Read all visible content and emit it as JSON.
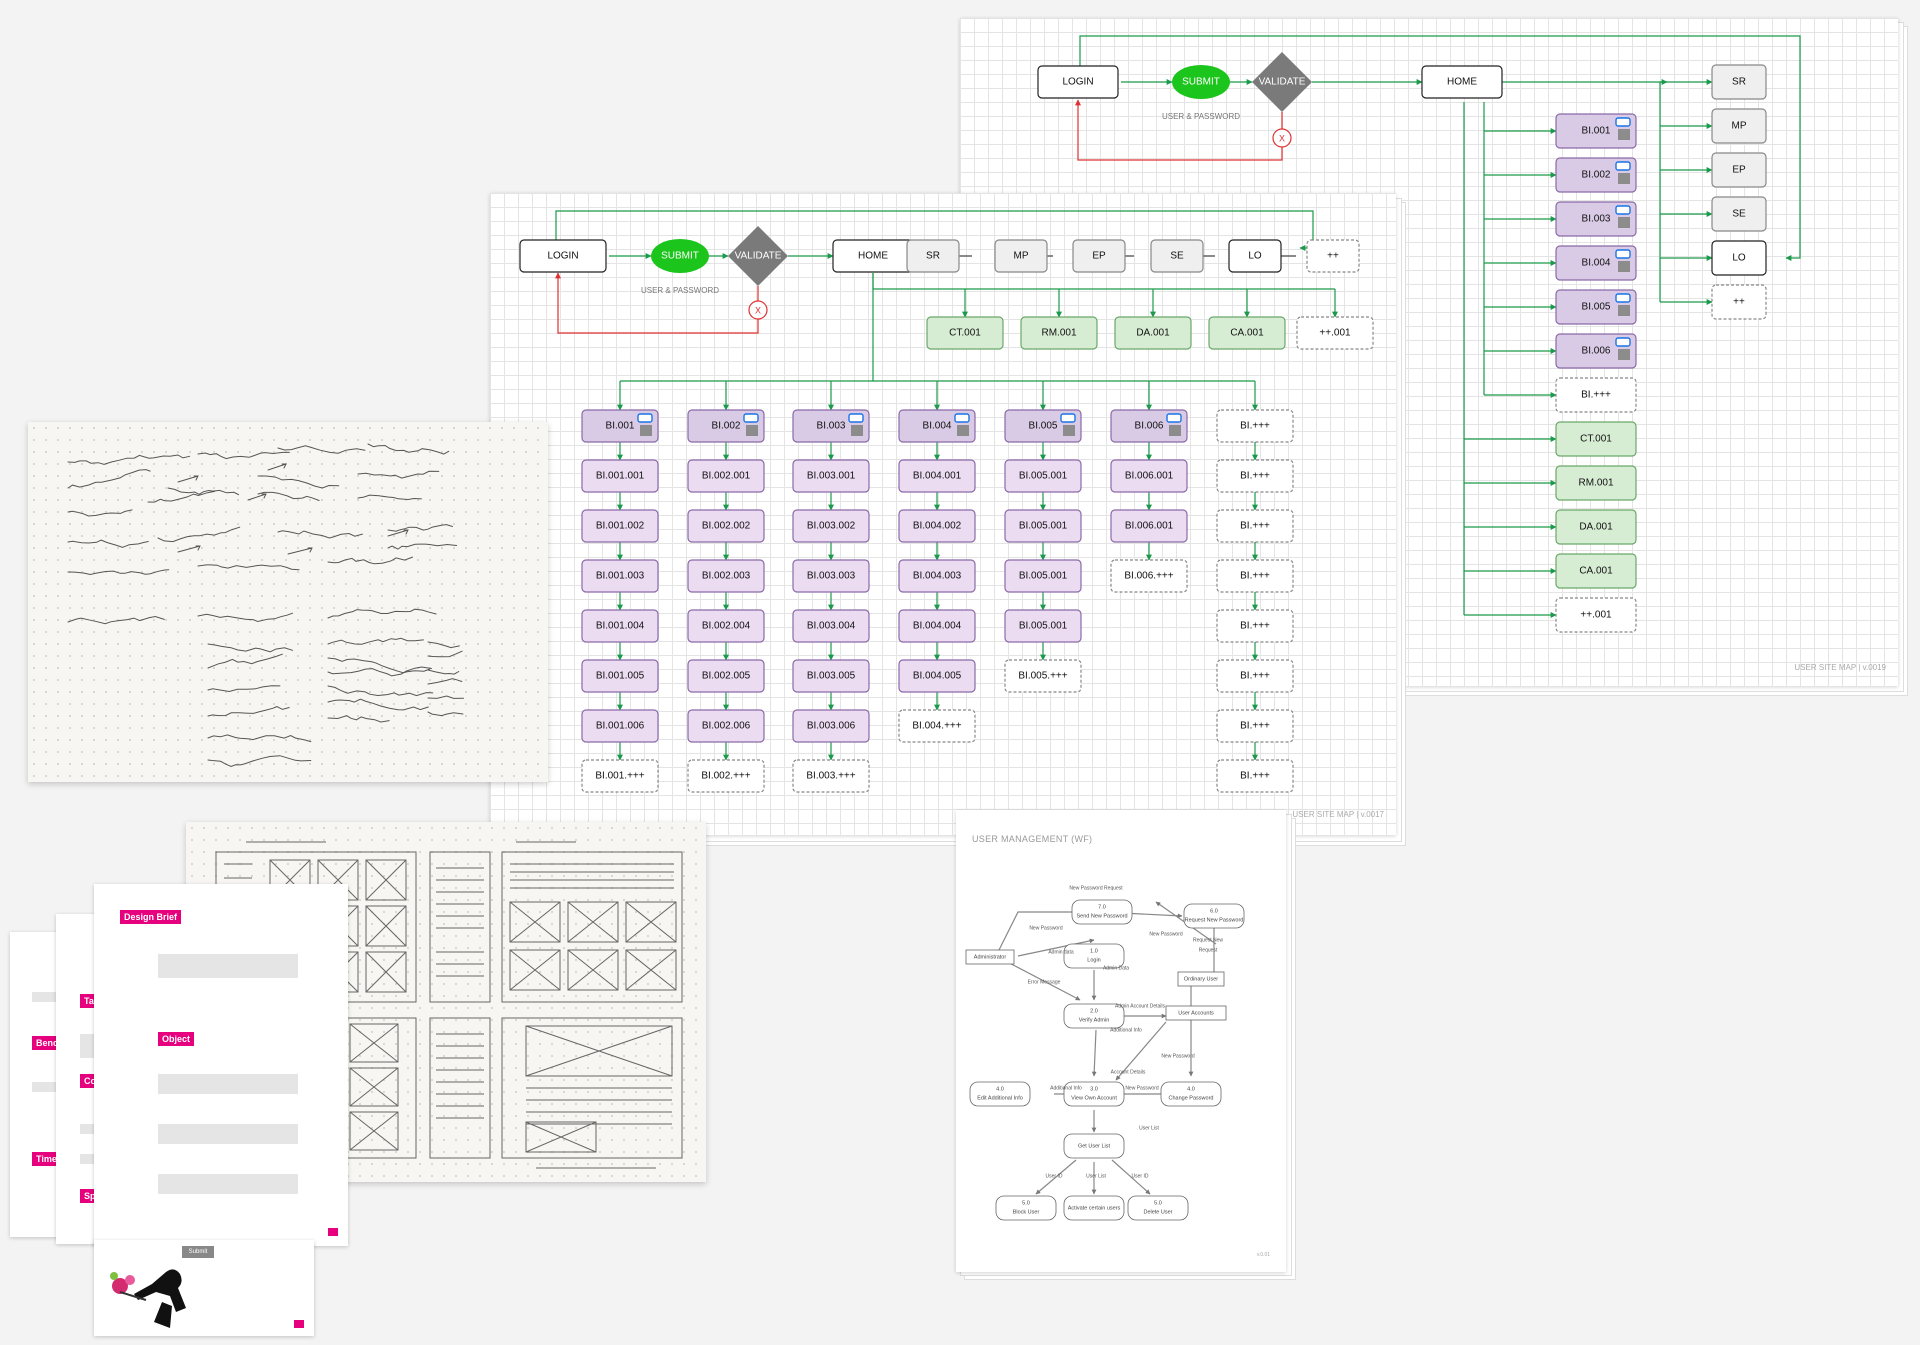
{
  "sitemap_back": {
    "nodes": {
      "login": "LOGIN",
      "submit": "SUBMIT",
      "validate": "VALIDATE",
      "home": "HOME",
      "x": "X"
    },
    "user_pw": "USER & PASSWORD",
    "right_items": [
      "SR",
      "MP",
      "EP",
      "SE",
      "LO",
      "++"
    ],
    "bi_items": [
      "BI.001",
      "BI.002",
      "BI.003",
      "BI.004",
      "BI.005",
      "BI.006",
      "BI.+++"
    ],
    "green_items": [
      "CT.001",
      "RM.001",
      "DA.001",
      "CA.001"
    ],
    "extra_item": "++.001",
    "footer": "USER SITE MAP | v.0019"
  },
  "sitemap_front": {
    "nodes": {
      "login": "LOGIN",
      "submit": "SUBMIT",
      "validate": "VALIDATE",
      "home": "HOME",
      "x": "X"
    },
    "user_pw": "USER & PASSWORD",
    "top_items": [
      "SR",
      "MP",
      "EP",
      "SE",
      "LO",
      "++"
    ],
    "green_items": [
      "CT.001",
      "RM.001",
      "DA.001",
      "CA.001",
      "++.001"
    ],
    "columns": [
      [
        "BI.001",
        "BI.001.001",
        "BI.001.002",
        "BI.001.003",
        "BI.001.004",
        "BI.001.005",
        "BI.001.006",
        "BI.001.+++"
      ],
      [
        "BI.002",
        "BI.002.001",
        "BI.002.002",
        "BI.002.003",
        "BI.002.004",
        "BI.002.005",
        "BI.002.006",
        "BI.002.+++"
      ],
      [
        "BI.003",
        "BI.003.001",
        "BI.003.002",
        "BI.003.003",
        "BI.003.004",
        "BI.003.005",
        "BI.003.006",
        "BI.003.+++"
      ],
      [
        "BI.004",
        "BI.004.001",
        "BI.004.002",
        "BI.004.003",
        "BI.004.004",
        "BI.004.005",
        "BI.004.+++"
      ],
      [
        "BI.005",
        "BI.005.001",
        "BI.005.001",
        "BI.005.001",
        "BI.005.001",
        "BI.005.+++"
      ],
      [
        "BI.006",
        "BI.006.001",
        "BI.006.001",
        "BI.006.+++"
      ],
      [
        "BI.+++",
        "BI.+++",
        "BI.+++",
        "BI.+++",
        "BI.+++",
        "BI.+++",
        "BI.+++",
        "BI.+++"
      ]
    ],
    "footer": "USER SITE MAP | v.0017"
  },
  "user_mgmt": {
    "title": "USER MANAGEMENT (WF)",
    "processes": [
      {
        "num": "7.0",
        "label": "Send New Password"
      },
      {
        "num": "6.0",
        "label": "Request New Password"
      },
      {
        "num": "1.0",
        "label": "Login"
      },
      {
        "num": "2.0",
        "label": "Verify Admin"
      },
      {
        "num": "4.0",
        "label": "Edit Additional Info"
      },
      {
        "num": "3.0",
        "label": "View Own Account"
      },
      {
        "num": "4.0",
        "label": "Change Password"
      },
      {
        "num": "",
        "label": "Get User List"
      },
      {
        "num": "5.0",
        "label": "Block User"
      },
      {
        "num": "",
        "label": "Activate certain users"
      },
      {
        "num": "5.0",
        "label": "Delete User"
      }
    ],
    "entities": [
      "Administrator",
      "Ordinary User",
      "User Accounts"
    ],
    "flows": [
      "New Password Request",
      "New Password",
      "New Password",
      "Admin data",
      "Admin Data",
      "Error Message",
      "Admin Account Details",
      "Additional Info",
      "Account Details",
      "Additional Info",
      "New Password",
      "New Password",
      "Request New",
      "Request",
      "User List",
      "User ID",
      "User List",
      "User ID"
    ],
    "footer": "v.0.01"
  },
  "design_brief": {
    "title": "Design Brief",
    "sections": [
      "Target market",
      "Benc",
      "Copy and pic",
      "Time",
      "Specification",
      "Object"
    ],
    "submit": "Submit"
  },
  "sketch_lines": [
    "LOGIN SCREENS",
    "DASHBOARD",
    "MENU",
    "PROFILE",
    "NOTIFICATIONS",
    "SEARCH",
    "FORGOT PASSWORD",
    "RESET PASSWORD",
    "VIEW",
    "SHARE",
    "COMMENT",
    "PRODUCT GRID",
    "ARTICLE VIEW"
  ],
  "colors": {
    "green_node": "#1cc51c",
    "decision": "#7a7a7a",
    "arrow_green": "#1a9a4a",
    "arrow_red": "#e03030",
    "bi_fill": "#d9cbe6",
    "bi_sub_fill": "#ecdcf2",
    "green_fill": "#d6ecd3",
    "pink": "#e6007e"
  }
}
